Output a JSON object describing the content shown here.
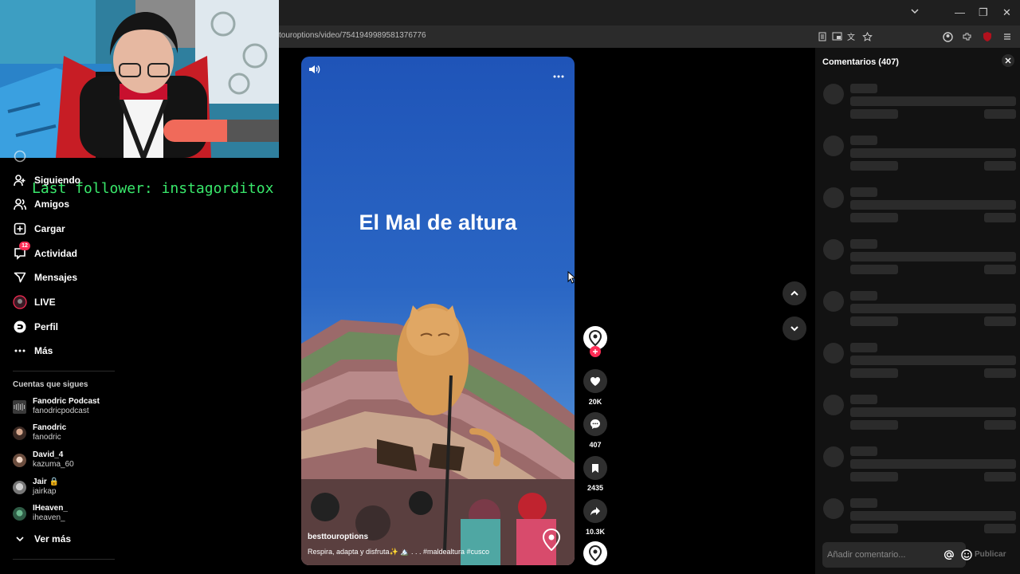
{
  "browser": {
    "url": "touroptions/video/7541949989581376776",
    "window_controls": {
      "minimize": "—",
      "restore": "❐",
      "close": "✕"
    }
  },
  "overlay": {
    "last_follower": "Last follower: instagorditox"
  },
  "sidebar": {
    "nav": [
      {
        "label": "Siguiendo",
        "icon": "user-follow-icon"
      },
      {
        "label": "Amigos",
        "icon": "friends-icon"
      },
      {
        "label": "Cargar",
        "icon": "upload-icon"
      },
      {
        "label": "Actividad",
        "icon": "activity-icon",
        "badge": "12"
      },
      {
        "label": "Mensajes",
        "icon": "messages-icon"
      },
      {
        "label": "LIVE",
        "icon": "live-icon"
      },
      {
        "label": "Perfil",
        "icon": "profile-icon"
      },
      {
        "label": "Más",
        "icon": "more-icon"
      }
    ],
    "following_title": "Cuentas que sigues",
    "accounts": [
      {
        "name": "Fanodric Podcast",
        "handle": "fanodricpodcast"
      },
      {
        "name": "Fanodric",
        "handle": "fanodric"
      },
      {
        "name": "David_4",
        "handle": "kazuma_60"
      },
      {
        "name": "Jair 🔒",
        "handle": "jairkap"
      },
      {
        "name": "IHeaven_",
        "handle": "iheaven_"
      }
    ],
    "see_more": "Ver más"
  },
  "video": {
    "title": "El Mal de altura",
    "username": "besttouroptions",
    "caption": "Respira, adapta y disfruta✨ 🏔️ . . . #maldealtura #cusco",
    "likes": "20K",
    "comments": "407",
    "saves": "2435",
    "shares": "10.3K"
  },
  "comments": {
    "title": "Comentarios (407)",
    "input_placeholder": "Añadir comentario...",
    "publish_label": "Publicar"
  },
  "colors": {
    "follower_text": "#39e86b",
    "badge": "#fe2c55",
    "panel_bg": "#121212",
    "skeleton": "#2b2b2b"
  }
}
